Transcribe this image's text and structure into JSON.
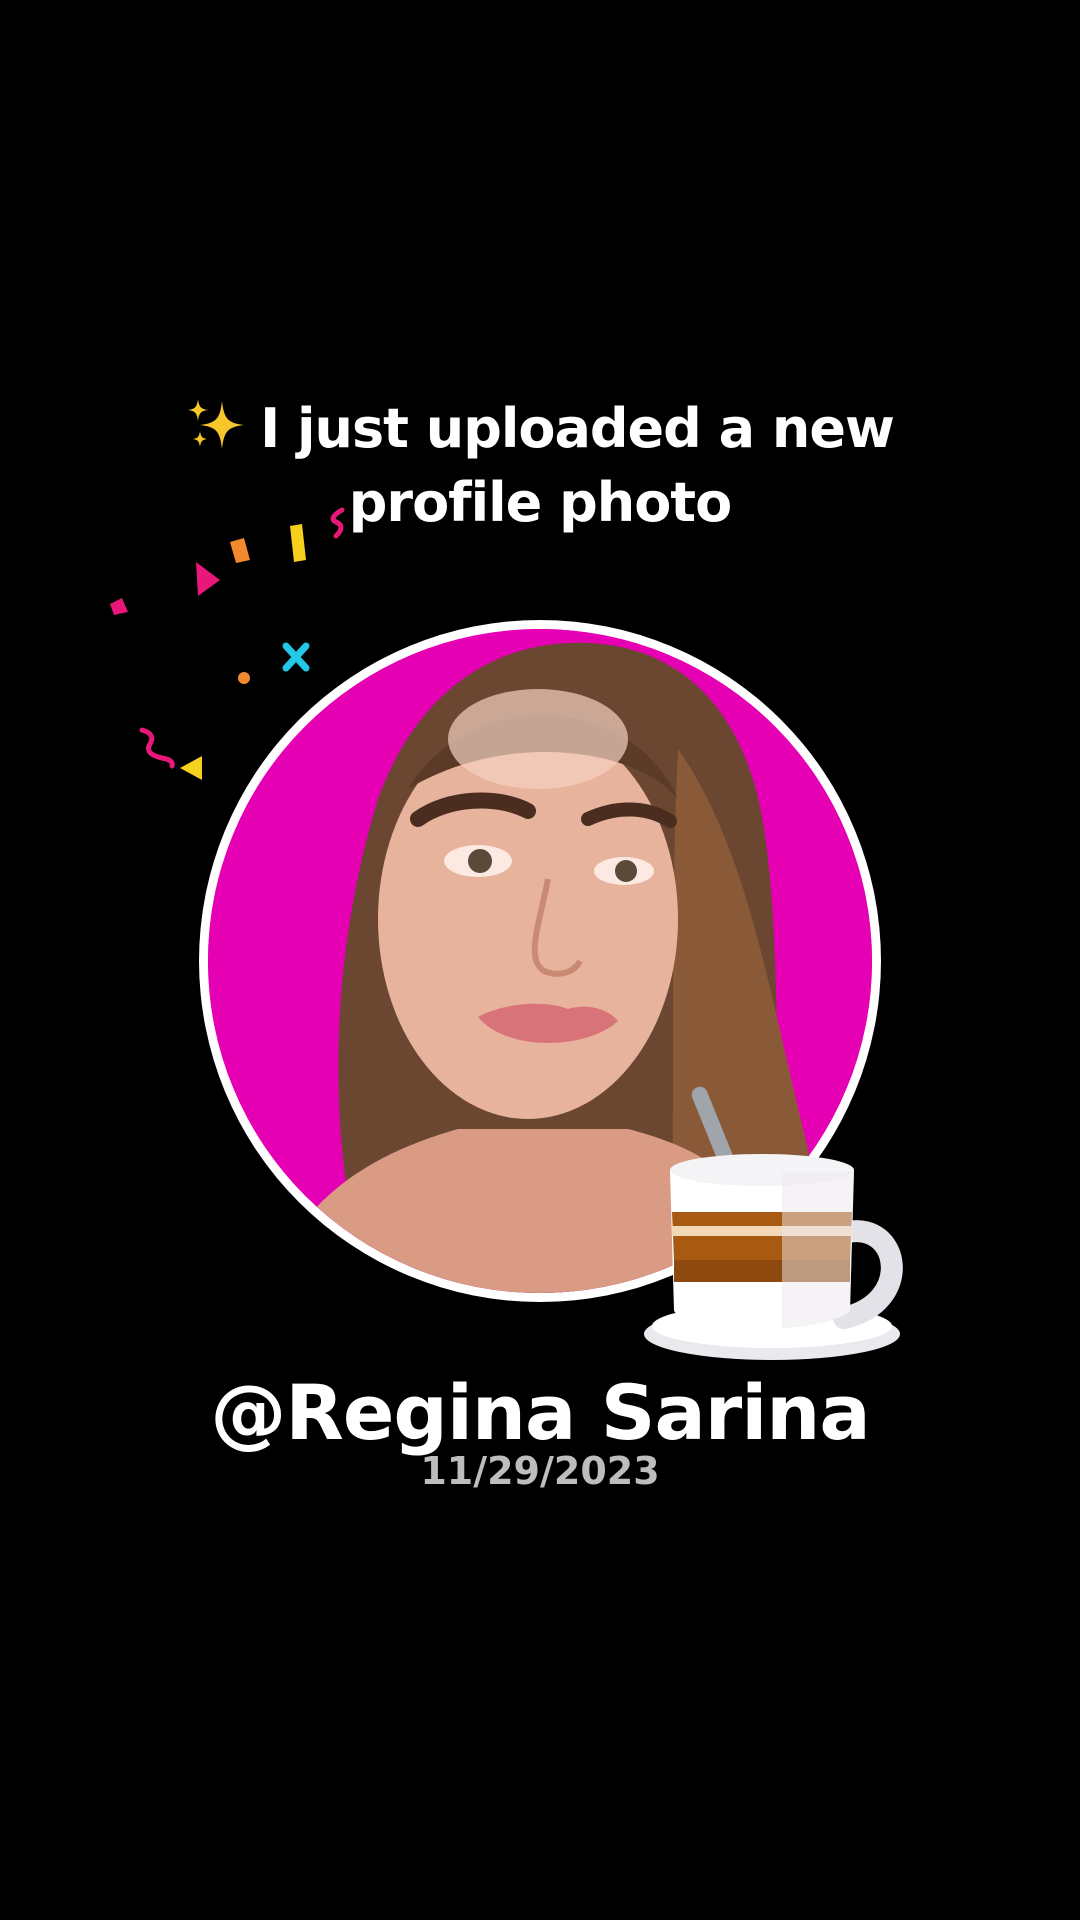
{
  "headline": {
    "text": "I just uploaded a new profile photo",
    "icon": "sparkles-icon"
  },
  "profile": {
    "username": "@Regina Sarina",
    "date": "11/29/2023",
    "avatar_icon": "profile-photo",
    "sticker_icon": "coffee-cup-icon"
  },
  "colors": {
    "background": "#000000",
    "avatar_bg": "#e600b4",
    "ring": "#ffffff",
    "date_text": "#bdbdbd",
    "confetti": [
      "#e8177a",
      "#f28a2d",
      "#f7cf1d",
      "#22c8e6"
    ]
  }
}
